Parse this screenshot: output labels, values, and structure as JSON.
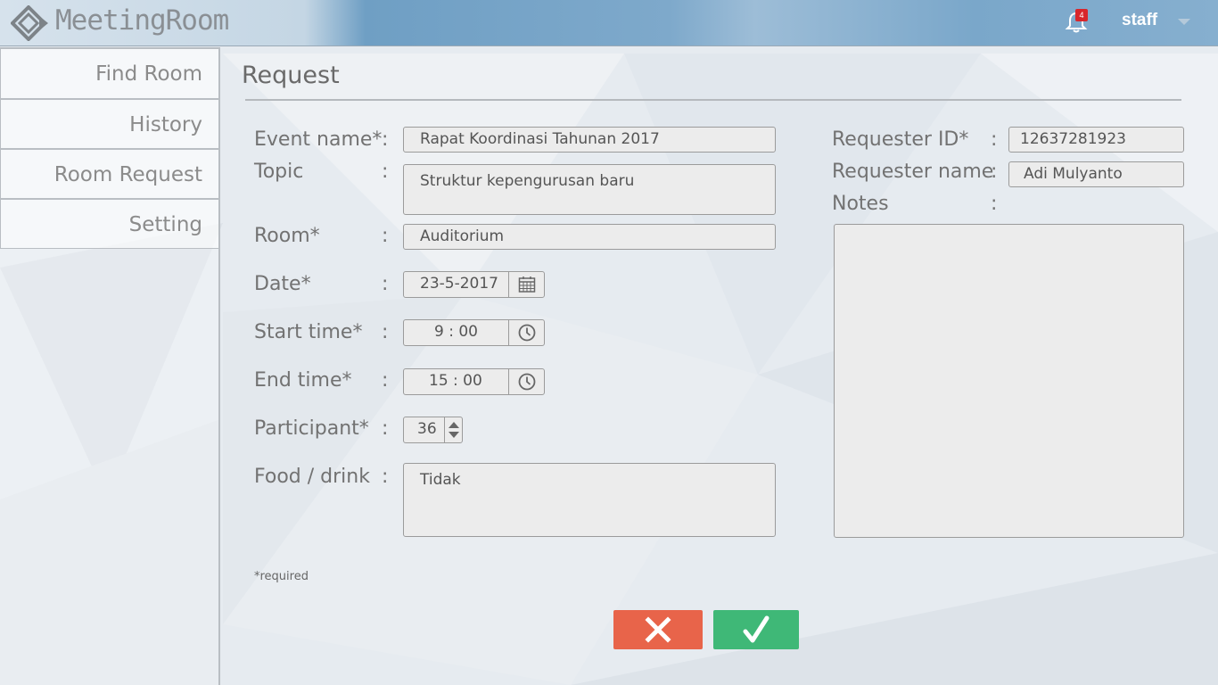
{
  "header": {
    "app_title": "MeetingRoom",
    "notification_count": "4",
    "user_name": "staff"
  },
  "sidebar": {
    "items": [
      {
        "label": "Find Room"
      },
      {
        "label": "History"
      },
      {
        "label": "Room Request"
      },
      {
        "label": "Setting"
      }
    ]
  },
  "page": {
    "title": "Request",
    "required_note": "*required"
  },
  "form": {
    "event_name": {
      "label": "Event name*",
      "value": "Rapat Koordinasi Tahunan 2017"
    },
    "topic": {
      "label": "Topic",
      "value": "Struktur kepengurusan baru"
    },
    "room": {
      "label": "Room*",
      "value": "Auditorium"
    },
    "date": {
      "label": "Date*",
      "value": "23-5-2017"
    },
    "start_time": {
      "label": "Start time*",
      "value": "9 : 00"
    },
    "end_time": {
      "label": "End time*",
      "value": "15 : 00"
    },
    "participant": {
      "label": "Participant*",
      "value": "36"
    },
    "food_drink": {
      "label": "Food / drink",
      "value": "Tidak"
    },
    "requester_id": {
      "label": "Requester ID*",
      "value": "12637281923"
    },
    "requester_name": {
      "label": "Requester name",
      "value": "Adi Mulyanto"
    },
    "notes": {
      "label": "Notes",
      "value": ""
    },
    "colon": ":"
  },
  "icons": {
    "logo": "diamond-logo-icon",
    "bell": "bell-icon",
    "caret": "chevron-down-icon",
    "calendar": "calendar-icon",
    "clock": "clock-icon",
    "stepper": "stepper-arrows-icon",
    "cancel": "close-icon",
    "confirm": "checkmark-icon"
  },
  "colors": {
    "cancel_button": "#e8644a",
    "confirm_button": "#3fb877",
    "badge": "#d8262b"
  }
}
